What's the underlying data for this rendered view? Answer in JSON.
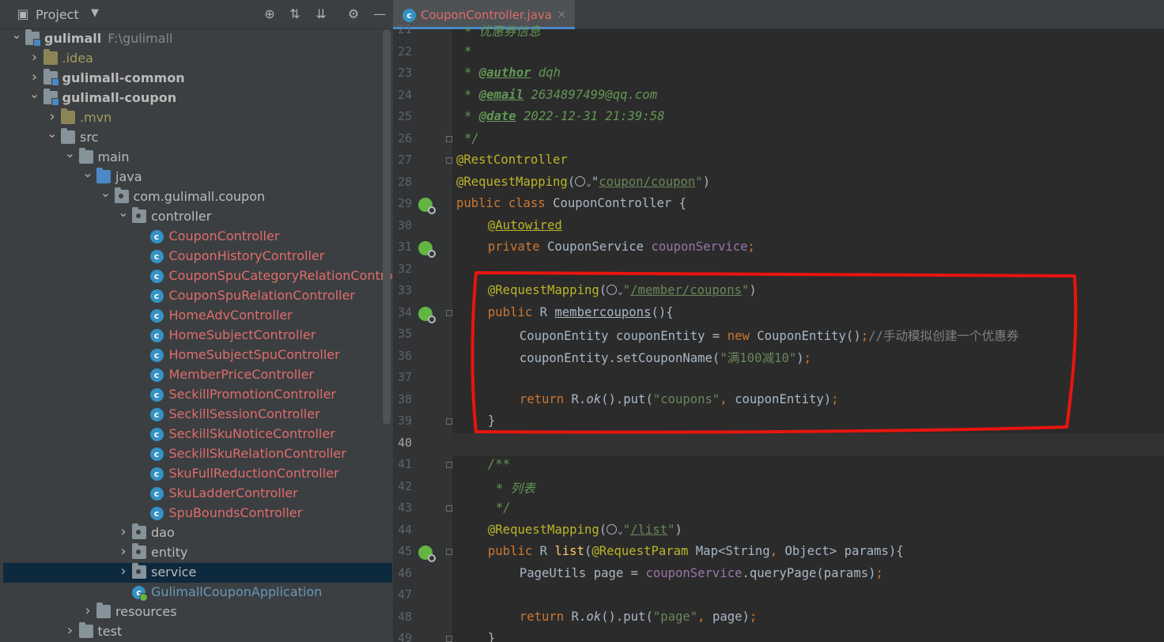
{
  "project": {
    "title": "Project",
    "header_icons": [
      "project-view-icon",
      "locate-icon",
      "expand-all-icon",
      "collapse-all-icon",
      "settings-icon",
      "hide-icon"
    ]
  },
  "tree": [
    {
      "label": "gulimall",
      "path": "F:\\gulimall",
      "level": 0,
      "icon": "module",
      "expanded": true,
      "bold": true
    },
    {
      "label": ".idea",
      "level": 1,
      "icon": "folder-yellow",
      "expanded": false,
      "style": "yellow"
    },
    {
      "label": "gulimall-common",
      "level": 1,
      "icon": "module",
      "expanded": false,
      "bold": true
    },
    {
      "label": "gulimall-coupon",
      "level": 1,
      "icon": "module",
      "expanded": true,
      "bold": true
    },
    {
      "label": ".mvn",
      "level": 2,
      "icon": "folder-yellow",
      "expanded": false,
      "style": "yellow"
    },
    {
      "label": "src",
      "level": 2,
      "icon": "folder",
      "expanded": true
    },
    {
      "label": "main",
      "level": 3,
      "icon": "folder",
      "expanded": true
    },
    {
      "label": "java",
      "level": 4,
      "icon": "folder-blue",
      "expanded": true
    },
    {
      "label": "com.gulimall.coupon",
      "level": 5,
      "icon": "package",
      "expanded": true
    },
    {
      "label": "controller",
      "level": 6,
      "icon": "package",
      "expanded": true
    },
    {
      "label": "CouponController",
      "level": 7,
      "icon": "class",
      "style": "red"
    },
    {
      "label": "CouponHistoryController",
      "level": 7,
      "icon": "class",
      "style": "red"
    },
    {
      "label": "CouponSpuCategoryRelationController",
      "level": 7,
      "icon": "class",
      "style": "red"
    },
    {
      "label": "CouponSpuRelationController",
      "level": 7,
      "icon": "class",
      "style": "red"
    },
    {
      "label": "HomeAdvController",
      "level": 7,
      "icon": "class",
      "style": "red"
    },
    {
      "label": "HomeSubjectController",
      "level": 7,
      "icon": "class",
      "style": "red"
    },
    {
      "label": "HomeSubjectSpuController",
      "level": 7,
      "icon": "class",
      "style": "red"
    },
    {
      "label": "MemberPriceController",
      "level": 7,
      "icon": "class",
      "style": "red"
    },
    {
      "label": "SeckillPromotionController",
      "level": 7,
      "icon": "class",
      "style": "red"
    },
    {
      "label": "SeckillSessionController",
      "level": 7,
      "icon": "class",
      "style": "red"
    },
    {
      "label": "SeckillSkuNoticeController",
      "level": 7,
      "icon": "class",
      "style": "red"
    },
    {
      "label": "SeckillSkuRelationController",
      "level": 7,
      "icon": "class",
      "style": "red"
    },
    {
      "label": "SkuFullReductionController",
      "level": 7,
      "icon": "class",
      "style": "red"
    },
    {
      "label": "SkuLadderController",
      "level": 7,
      "icon": "class",
      "style": "red"
    },
    {
      "label": "SpuBoundsController",
      "level": 7,
      "icon": "class",
      "style": "red"
    },
    {
      "label": "dao",
      "level": 6,
      "icon": "package",
      "expanded": false
    },
    {
      "label": "entity",
      "level": 6,
      "icon": "package",
      "expanded": false
    },
    {
      "label": "service",
      "level": 6,
      "icon": "package",
      "expanded": false,
      "selected": true
    },
    {
      "label": "GulimallCouponApplication",
      "level": 6,
      "icon": "app-class",
      "style": "blue"
    },
    {
      "label": "resources",
      "level": 4,
      "icon": "folder",
      "expanded": false
    },
    {
      "label": "test",
      "level": 3,
      "icon": "folder",
      "expanded": false
    }
  ],
  "editor": {
    "tab_label": "CouponController.java",
    "tab_close": "×",
    "current_line": 40,
    "lines": [
      {
        "n": 21,
        "indent": 1,
        "tokens": [
          [
            "doc",
            "* 优惠券信息"
          ]
        ]
      },
      {
        "n": 22,
        "indent": 1,
        "tokens": [
          [
            "doc",
            "*"
          ]
        ]
      },
      {
        "n": 23,
        "indent": 1,
        "tokens": [
          [
            "doc",
            "* "
          ],
          [
            "doctag",
            "@author"
          ],
          [
            "doc",
            " dqh"
          ]
        ]
      },
      {
        "n": 24,
        "indent": 1,
        "tokens": [
          [
            "doc",
            "* "
          ],
          [
            "doctag",
            "@email"
          ],
          [
            "doc",
            " 2634897499@qq.com"
          ]
        ]
      },
      {
        "n": 25,
        "indent": 1,
        "tokens": [
          [
            "doc",
            "* "
          ],
          [
            "doctag",
            "@date"
          ],
          [
            "doc",
            " 2022-12-31 21:39:58"
          ]
        ]
      },
      {
        "n": 26,
        "indent": 1,
        "tokens": [
          [
            "doc",
            "*/"
          ]
        ],
        "fold": true
      },
      {
        "n": 27,
        "indent": 0,
        "tokens": [
          [
            "ann",
            "@RestController"
          ]
        ],
        "fold": true
      },
      {
        "n": 28,
        "indent": 0,
        "tokens": [
          [
            "ann",
            "@RequestMapping"
          ],
          [
            "plain",
            "("
          ],
          [
            "globe",
            ""
          ],
          [
            "plain",
            "\""
          ],
          [
            "strul",
            "coupon/coupon"
          ],
          [
            "str",
            "\""
          ],
          [
            "plain",
            ")"
          ]
        ]
      },
      {
        "n": 29,
        "indent": 0,
        "tokens": [
          [
            "kw",
            "public class "
          ],
          [
            "plain",
            "CouponController {"
          ]
        ],
        "gicon": true
      },
      {
        "n": 30,
        "indent": 4,
        "tokens": [
          [
            "annul",
            "@Autowired"
          ]
        ]
      },
      {
        "n": 31,
        "indent": 4,
        "tokens": [
          [
            "kw",
            "private "
          ],
          [
            "plain",
            "CouponService "
          ],
          [
            "fld",
            "couponService"
          ],
          [
            "kw",
            ";"
          ]
        ],
        "gicon": true
      },
      {
        "n": 32,
        "indent": 0,
        "tokens": []
      },
      {
        "n": 33,
        "indent": 4,
        "tokens": [
          [
            "ann",
            "@RequestMapping"
          ],
          [
            "plain",
            "("
          ],
          [
            "globe",
            ""
          ],
          [
            "str",
            "\""
          ],
          [
            "strul",
            "/member/coupons"
          ],
          [
            "str",
            "\""
          ],
          [
            "plain",
            ")"
          ]
        ]
      },
      {
        "n": 34,
        "indent": 4,
        "tokens": [
          [
            "kw",
            "public "
          ],
          [
            "plain",
            "R "
          ],
          [
            "methul",
            "membercoupons"
          ],
          [
            "plain",
            "(){"
          ]
        ],
        "gicon": true,
        "fold": true
      },
      {
        "n": 35,
        "indent": 8,
        "tokens": [
          [
            "plain",
            "CouponEntity couponEntity = "
          ],
          [
            "kw",
            "new "
          ],
          [
            "plain",
            "CouponEntity()"
          ],
          [
            "kw",
            ";"
          ],
          [
            "cmt",
            "//手动模拟创建一个优惠券"
          ]
        ]
      },
      {
        "n": 36,
        "indent": 8,
        "tokens": [
          [
            "plain",
            "couponEntity.setCouponName("
          ],
          [
            "str",
            "\"满100减10\""
          ],
          [
            "plain",
            ")"
          ],
          [
            "kw",
            ";"
          ]
        ]
      },
      {
        "n": 37,
        "indent": 0,
        "tokens": []
      },
      {
        "n": 38,
        "indent": 8,
        "tokens": [
          [
            "kw",
            "return "
          ],
          [
            "plain",
            "R."
          ],
          [
            "it",
            "ok"
          ],
          [
            "plain",
            "().put("
          ],
          [
            "str",
            "\"coupons\""
          ],
          [
            "kw",
            ", "
          ],
          [
            "plain",
            "couponEntity)"
          ],
          [
            "kw",
            ";"
          ]
        ]
      },
      {
        "n": 39,
        "indent": 4,
        "tokens": [
          [
            "plain",
            "}"
          ]
        ],
        "fold": true
      },
      {
        "n": 40,
        "indent": 0,
        "tokens": []
      },
      {
        "n": 41,
        "indent": 4,
        "tokens": [
          [
            "doc",
            "/**"
          ]
        ],
        "fold": true
      },
      {
        "n": 42,
        "indent": 5,
        "tokens": [
          [
            "doc",
            "* 列表"
          ]
        ]
      },
      {
        "n": 43,
        "indent": 5,
        "tokens": [
          [
            "doc",
            "*/"
          ]
        ],
        "fold": true
      },
      {
        "n": 44,
        "indent": 4,
        "tokens": [
          [
            "ann",
            "@RequestMapping"
          ],
          [
            "plain",
            "("
          ],
          [
            "globe",
            ""
          ],
          [
            "str",
            "\""
          ],
          [
            "strul",
            "/list"
          ],
          [
            "str",
            "\""
          ],
          [
            "plain",
            ")"
          ]
        ]
      },
      {
        "n": 45,
        "indent": 4,
        "tokens": [
          [
            "kw",
            "public "
          ],
          [
            "plain",
            "R "
          ],
          [
            "meth",
            "list"
          ],
          [
            "plain",
            "("
          ],
          [
            "ann",
            "@RequestParam "
          ],
          [
            "plain",
            "Map<String"
          ],
          [
            "kw",
            ", "
          ],
          [
            "plain",
            "Object> params){"
          ]
        ],
        "gicon": true,
        "fold": true
      },
      {
        "n": 46,
        "indent": 8,
        "tokens": [
          [
            "plain",
            "PageUtils page = "
          ],
          [
            "fld",
            "couponService"
          ],
          [
            "plain",
            ".queryPage(params)"
          ],
          [
            "kw",
            ";"
          ]
        ]
      },
      {
        "n": 47,
        "indent": 0,
        "tokens": []
      },
      {
        "n": 48,
        "indent": 8,
        "tokens": [
          [
            "kw",
            "return "
          ],
          [
            "plain",
            "R."
          ],
          [
            "it",
            "ok"
          ],
          [
            "plain",
            "().put("
          ],
          [
            "str",
            "\"page\""
          ],
          [
            "kw",
            ", "
          ],
          [
            "plain",
            "page)"
          ],
          [
            "kw",
            ";"
          ]
        ]
      },
      {
        "n": 49,
        "indent": 4,
        "tokens": [
          [
            "plain",
            "}"
          ]
        ],
        "fold": true
      }
    ]
  },
  "colors": {
    "annotation_box": "#e8150f",
    "keyword": "#cc7832",
    "string": "#6a8759",
    "annotation": "#bbb529",
    "field": "#9876aa",
    "javadoc": "#629755"
  }
}
